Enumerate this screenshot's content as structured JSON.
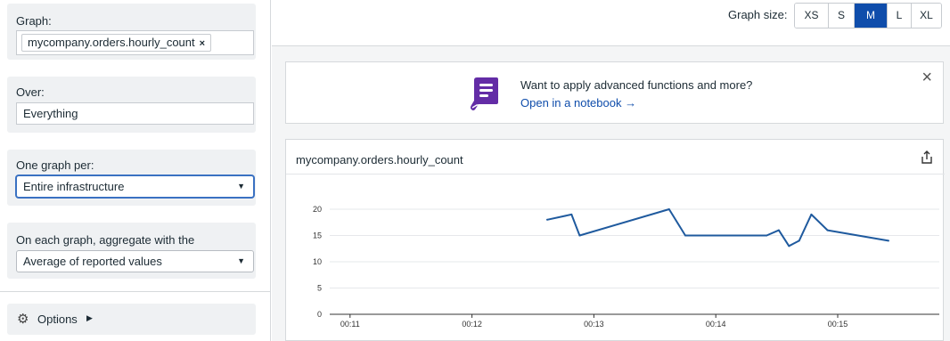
{
  "sidebar": {
    "graph_label": "Graph:",
    "graph_tag": "mycompany.orders.hourly_count",
    "graph_tag_remove": "×",
    "over_label": "Over:",
    "over_value": "Everything",
    "per_label": "One graph per:",
    "per_value": "Entire infrastructure",
    "aggregate_label": "On each graph, aggregate with the",
    "aggregate_value": "Average of reported values",
    "options_label": "Options",
    "options_icon": "gear-icon"
  },
  "topbar": {
    "size_label": "Graph size:",
    "sizes": [
      "XS",
      "S",
      "M",
      "L",
      "XL"
    ],
    "active_size": "M",
    "active_color": "#0f4dab"
  },
  "banner": {
    "text": "Want to apply advanced functions and more?",
    "link": "Open in a notebook →",
    "close": "×",
    "icon": "notebook-icon",
    "icon_color": "#632ca6"
  },
  "graph": {
    "title": "mycompany.orders.hourly_count",
    "share_icon": "export-icon"
  },
  "chart_data": {
    "type": "line",
    "series": [
      {
        "color": "#1f5a9e",
        "points": [
          [
            "00:12:37",
            18
          ],
          [
            "00:12:49",
            19
          ],
          [
            "00:12:53",
            15
          ],
          [
            "00:13:37",
            20
          ],
          [
            "00:13:45",
            15
          ],
          [
            "00:14:25",
            15
          ],
          [
            "00:14:31",
            16
          ],
          [
            "00:14:36",
            13
          ],
          [
            "00:14:41",
            14
          ],
          [
            "00:14:47",
            19
          ],
          [
            "00:14:55",
            16
          ],
          [
            "00:15:25",
            14
          ]
        ]
      }
    ],
    "xticks": [
      "00:11",
      "00:12",
      "00:13",
      "00:14",
      "00:15"
    ],
    "yticks": [
      0,
      5,
      10,
      15,
      20
    ],
    "ylim": [
      0,
      20
    ],
    "xlim": [
      "00:10:50",
      "00:15:50"
    ],
    "grid": true
  }
}
